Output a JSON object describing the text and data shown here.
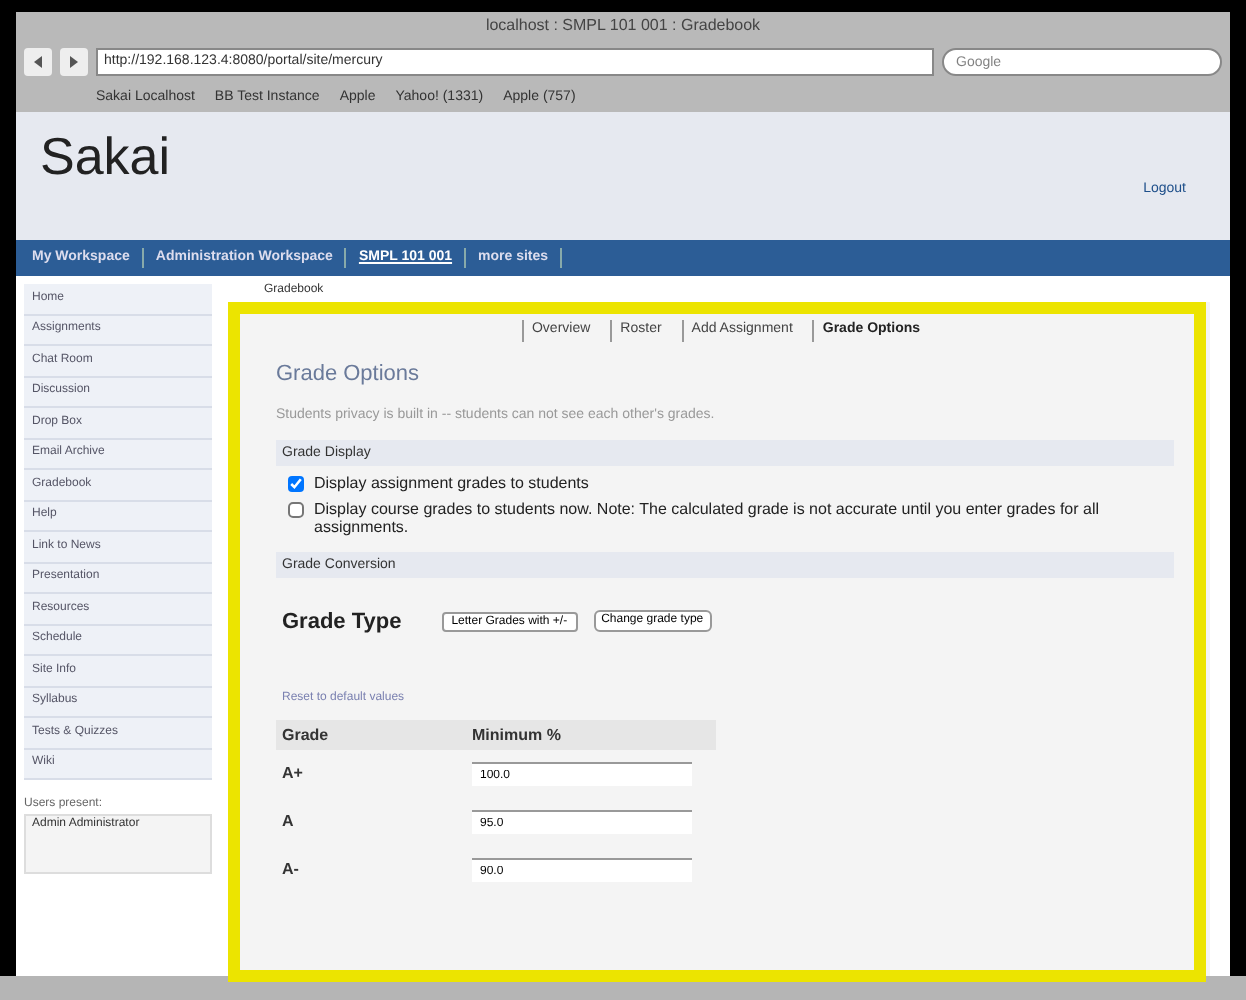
{
  "browser": {
    "title": "localhost : SMPL 101 001 : Gradebook",
    "url": "http://192.168.123.4:8080/portal/site/mercury",
    "search_placeholder": "Google",
    "bookmarks": [
      "Sakai Localhost",
      "BB Test Instance",
      "Apple",
      "Yahoo! (1331)",
      "Apple (757)"
    ]
  },
  "header": {
    "logo": "Sakai",
    "logout": "Logout"
  },
  "site_tabs": [
    {
      "label": "My Workspace",
      "selected": false
    },
    {
      "label": "Administration Workspace",
      "selected": false
    },
    {
      "label": "SMPL 101 001",
      "selected": true
    },
    {
      "label": "more sites",
      "selected": false
    }
  ],
  "sidebar": {
    "items": [
      "Home",
      "Assignments",
      "Chat Room",
      "Discussion",
      "Drop Box",
      "Email Archive",
      "Gradebook",
      "Help",
      "Link to News",
      "Presentation",
      "Resources",
      "Schedule",
      "Site Info",
      "Syllabus",
      "Tests & Quizzes",
      "Wiki"
    ],
    "users_label": "Users present:",
    "users": [
      "Admin Administrator"
    ]
  },
  "breadcrumb": "Gradebook",
  "tool_tabs": [
    {
      "label": "Overview",
      "selected": false
    },
    {
      "label": "Roster",
      "selected": false
    },
    {
      "label": "Add Assignment",
      "selected": false
    },
    {
      "label": "Grade Options",
      "selected": true
    }
  ],
  "title": "Grade Options",
  "note": "Students privacy is built in -- students can not see each other's grades.",
  "display_section": "Grade Display",
  "options": [
    {
      "label": "Display assignment grades to students",
      "checked": true
    },
    {
      "label": "Display course grades to students now. Note: The calculated grade is not accurate until you enter grades for all assignments.",
      "checked": false
    }
  ],
  "conversion_section": "Grade Conversion",
  "grade_type": {
    "label": "Grade Type",
    "value": "Letter Grades with +/-",
    "button": "Change grade type"
  },
  "reset_link": "Reset to default values",
  "table": {
    "columns": [
      "Grade",
      "Minimum %"
    ],
    "rows": [
      {
        "grade": "A+",
        "minimum": "100.0"
      },
      {
        "grade": "A",
        "minimum": "95.0"
      },
      {
        "grade": "A-",
        "minimum": "90.0"
      }
    ]
  }
}
